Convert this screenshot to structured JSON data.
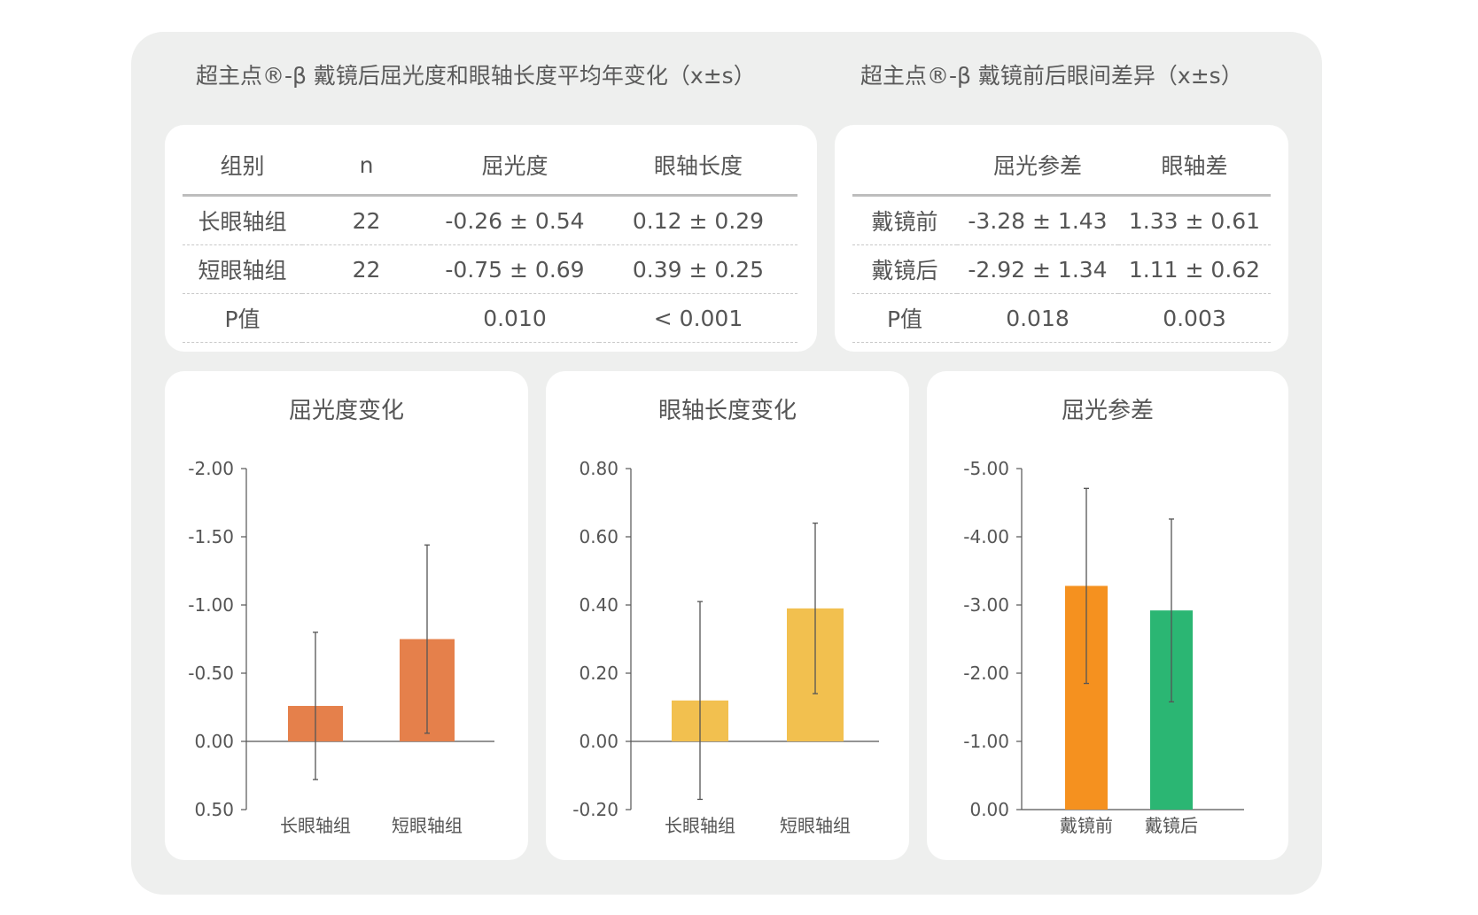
{
  "headings": {
    "left": "超主点®-β 戴镜后屈光度和眼轴长度平均年变化（x±s）",
    "right": "超主点®-β 戴镜前后眼间差异（x±s）"
  },
  "table_left": {
    "headers": [
      "组别",
      "n",
      "屈光度",
      "眼轴长度"
    ],
    "rows": [
      [
        "长眼轴组",
        "22",
        "-0.26 ± 0.54",
        "0.12 ± 0.29"
      ],
      [
        "短眼轴组",
        "22",
        "-0.75 ± 0.69",
        "0.39 ± 0.25"
      ],
      [
        "P值",
        "",
        "0.010",
        "< 0.001"
      ]
    ]
  },
  "table_right": {
    "headers": [
      "",
      "屈光参差",
      "眼轴差"
    ],
    "rows": [
      [
        "戴镜前",
        "-3.28 ± 1.43",
        "1.33 ± 0.61"
      ],
      [
        "戴镜后",
        "-2.92 ± 1.34",
        "1.11 ± 0.62"
      ],
      [
        "P值",
        "0.018",
        "0.003"
      ]
    ]
  },
  "chart_data": [
    {
      "type": "bar",
      "title": "屈光度变化",
      "categories": [
        "长眼轴组",
        "短眼轴组"
      ],
      "values": [
        -0.26,
        -0.75
      ],
      "errors": [
        0.54,
        0.69
      ],
      "ylim": [
        0.5,
        -2.0
      ],
      "yticks": [
        -2.0,
        -1.5,
        -1.0,
        -0.5,
        0.0,
        0.5
      ],
      "ytick_labels": [
        "-2.00",
        "-1.50",
        "-1.00",
        "-0.50",
        "0.00",
        "0.50"
      ],
      "colors": [
        "#e5804b",
        "#e5804b"
      ],
      "reversed_axis": true,
      "grid": false
    },
    {
      "type": "bar",
      "title": "眼轴长度变化",
      "categories": [
        "长眼轴组",
        "短眼轴组"
      ],
      "values": [
        0.12,
        0.39
      ],
      "errors": [
        0.29,
        0.25
      ],
      "ylim": [
        -0.2,
        0.8
      ],
      "yticks": [
        -0.2,
        0.0,
        0.2,
        0.4,
        0.6,
        0.8
      ],
      "ytick_labels": [
        "-0.20",
        "0.00",
        "0.20",
        "0.40",
        "0.60",
        "0.80"
      ],
      "colors": [
        "#f2c04f",
        "#f2c04f"
      ],
      "reversed_axis": false,
      "grid": false
    },
    {
      "type": "bar",
      "title": "屈光参差",
      "categories": [
        "戴镜前",
        "戴镜后"
      ],
      "values": [
        -3.28,
        -2.92
      ],
      "errors": [
        1.43,
        1.34
      ],
      "ylim": [
        0.0,
        -5.0
      ],
      "yticks": [
        0.0,
        -1.0,
        -2.0,
        -3.0,
        -4.0,
        -5.0
      ],
      "ytick_labels": [
        "0.00",
        "-1.00",
        "-2.00",
        "-3.00",
        "-4.00",
        "-5.00"
      ],
      "colors": [
        "#f5911f",
        "#2bb673"
      ],
      "reversed_axis": true,
      "grid": false
    }
  ]
}
